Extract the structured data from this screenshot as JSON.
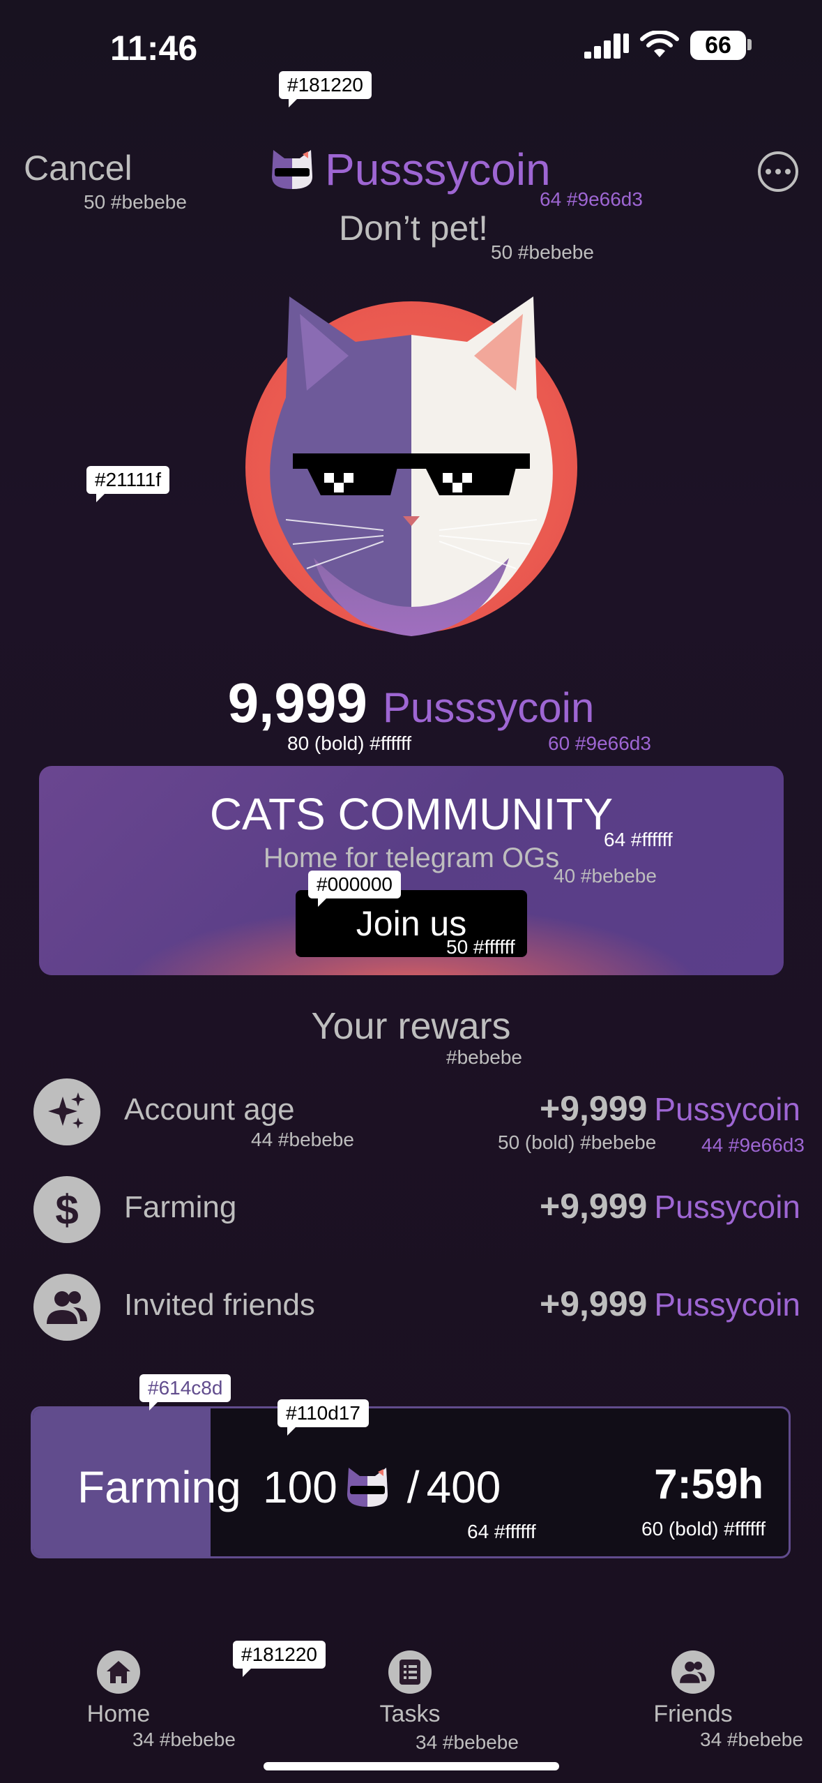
{
  "status_bar": {
    "time": "11:46",
    "battery": "66"
  },
  "header": {
    "cancel_label": "Cancel",
    "title": "Pusssycoin",
    "subtitle": "Don’t pet!"
  },
  "balance": {
    "amount": "9,999",
    "unit": "Pusssycoin"
  },
  "community": {
    "title": "CATS COMMUNITY",
    "subtitle": "Home for telegram OGs",
    "button_label": "Join us"
  },
  "rewards": {
    "title": "Your rewars",
    "items": [
      {
        "label": "Account age",
        "amount": "+9,999",
        "unit": "Pussycoin",
        "icon": "sparkles-icon"
      },
      {
        "label": "Farming",
        "amount": "+9,999",
        "unit": "Pussycoin",
        "icon": "dollar-icon"
      },
      {
        "label": "Invited friends",
        "amount": "+9,999",
        "unit": "Pussycoin",
        "icon": "friends-icon"
      }
    ]
  },
  "farming": {
    "label": "Farming",
    "current": "100",
    "separator": "/",
    "total": "400",
    "time_left": "7:59h",
    "progress_fraction": 0.235
  },
  "nav": {
    "items": [
      {
        "label": "Home",
        "icon": "home-icon"
      },
      {
        "label": "Tasks",
        "icon": "tasks-icon"
      },
      {
        "label": "Friends",
        "icon": "friends-icon"
      }
    ]
  },
  "annotations": {
    "bg_top_tag": "#181220",
    "cancel_spec": "50 #bebebe",
    "title_spec": "64 #9e66d3",
    "subtitle_spec": "50 #bebebe",
    "bg_mid_tag": "#21111f",
    "balance_spec": "80 (bold) #ffffff",
    "balance_unit_spec": "60 #9e66d3",
    "community_title_spec": "64 #ffffff",
    "community_sub_spec": "40 #bebebe",
    "join_bg_tag": "#000000",
    "join_spec": "50 #ffffff",
    "rewards_title_spec": "#bebebe",
    "reward_label_spec": "44 #bebebe",
    "reward_amount_spec": "50 (bold) #bebebe",
    "reward_unit_spec": "44 #9e66d3",
    "farm_fill_tag": "#614c8d",
    "farm_bg_tag": "#110d17",
    "farm_text_spec": "64 #ffffff",
    "farm_time_spec": "60 (bold) #ffffff",
    "nav_bg_tag": "#181220",
    "nav_home_spec": "34 #bebebe",
    "nav_tasks_spec": "34 #bebebe",
    "nav_friends_spec": "34 #bebebe"
  },
  "colors": {
    "accent": "#9e66d3",
    "text_grey": "#bebebe",
    "farm_fill": "#614c8d",
    "farm_bg": "#110d17",
    "background": "#181220"
  }
}
